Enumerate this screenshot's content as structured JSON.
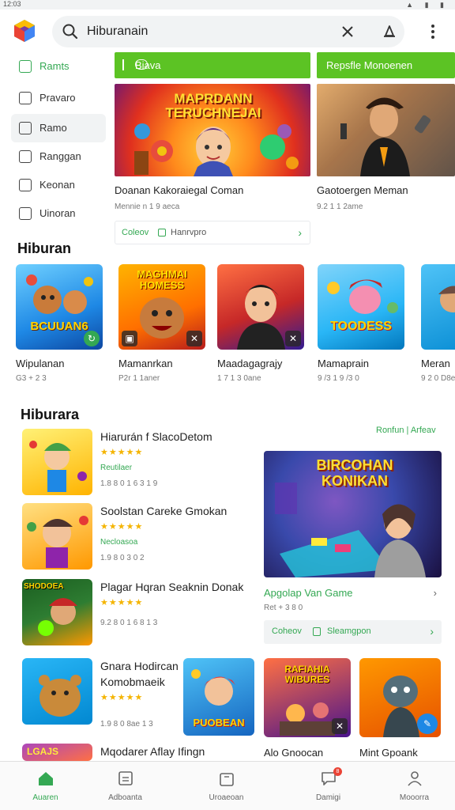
{
  "status": {
    "time": "12:03"
  },
  "search": {
    "value": "Hiburanain"
  },
  "sidebar": {
    "items": [
      {
        "label": "Ramts"
      },
      {
        "label": "Pravaro"
      },
      {
        "label": "Ramo"
      },
      {
        "label": "Ranggan"
      },
      {
        "label": "Keonan"
      },
      {
        "label": "Uinoran"
      }
    ]
  },
  "banners": [
    {
      "header": "Biava",
      "title": "Doanan Kakoraiegal Coman",
      "meta": "Mennie n 1 9 aeca",
      "foot_left": "Coleov",
      "foot_right": "Hanrvpro"
    },
    {
      "header": "Repsfle Monoenen",
      "title": "Gaotoergen Meman",
      "meta": "9.2 1 1 2ame"
    }
  ],
  "section1": {
    "title": "Hiburan",
    "tiles": [
      {
        "name": "Wipulanan",
        "meta": "G3 + 2 3"
      },
      {
        "name": "Mamanrkan",
        "meta": "P2r 1 1aner"
      },
      {
        "name": "Maadagagrajy",
        "meta": "1 7 1 3 0ane"
      },
      {
        "name": "Mamaprain",
        "meta": "9 /3 1 9 /3 0"
      },
      {
        "name": "Meran",
        "meta": "9 2 0 D8e"
      }
    ]
  },
  "section2": {
    "title": "Hiburara",
    "see_all": "Ronfun | Arfeav",
    "list": [
      {
        "title": "Hiarurán f SlacoDetom",
        "stars": "★★★★★",
        "green": "Reutilaer",
        "meta": "1.8 8 0 1 6 3 1 9"
      },
      {
        "title": "Soolstan Careke Gmokan",
        "stars": "★★★★★",
        "green": "Necloasoa",
        "meta": "1.9 8 0 3 0 2"
      },
      {
        "title": "Plagar Hqran Seaknin Donak",
        "stars": "★★★★★",
        "green": "",
        "meta": "9.2 8 0 1 6 8 1 3"
      },
      {
        "title": "Gnara Hodircan Komobmaeik",
        "stars": "★★★★★",
        "green": "",
        "meta": "1.9 8 0 8ae 1 3"
      },
      {
        "title": "Mqodarer Aflay Ifingn",
        "stars": "",
        "green": "",
        "meta": ""
      }
    ],
    "feature": {
      "title": "Apgolap Van Game",
      "meta": "Ret + 3 8 0",
      "foot_left": "Coheov",
      "foot_right": "Sleamgpon"
    },
    "bottom_tiles": [
      {
        "name": "Alo Gnoocan"
      },
      {
        "name": "Mint Gpoank"
      }
    ],
    "art_text": {
      "banner1": "MAPRDANN TERUCHNEJAI",
      "tile1": "BCUUAN6",
      "tile2": "MAGHMAI HOMESS",
      "tile4": "TOODESS",
      "feature": "BIRCOHAN KONIKAN",
      "li3": "SHODOEA",
      "tile_b1": "PUOBEAN",
      "tile_b2": "RAFIAHIA WIBURES",
      "li5": "LGAJS"
    }
  },
  "bottomnav": [
    {
      "label": "Auaren",
      "icon": "home-icon"
    },
    {
      "label": "Adboanta",
      "icon": "apps-icon"
    },
    {
      "label": "Uroaeoan",
      "icon": "bag-icon"
    },
    {
      "label": "Damigi",
      "icon": "chat-icon",
      "badge": "8"
    },
    {
      "label": "Mooorra",
      "icon": "profile-icon"
    }
  ],
  "colors": {
    "accent": "#34a853",
    "banner_bar": "#5cc324",
    "star": "#f4b400"
  }
}
